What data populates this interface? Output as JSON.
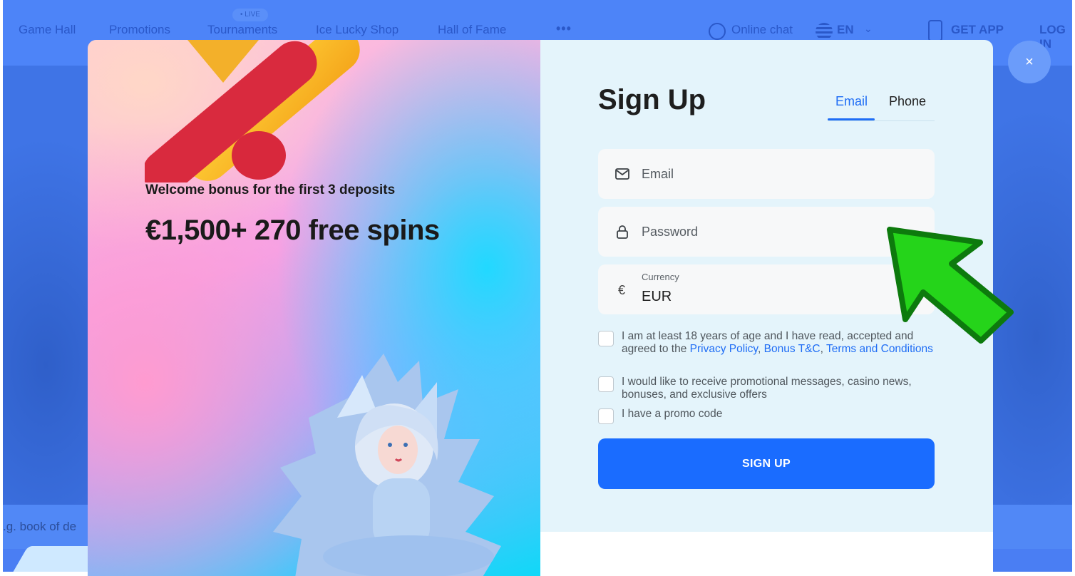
{
  "site": {
    "nav": {
      "game_hall": "Game Hall",
      "promotions": "Promotions",
      "tournaments": "Tournaments",
      "live_badge": "• LIVE",
      "ice_lucky_shop": "Ice Lucky Shop",
      "hall_of_fame": "Hall of Fame",
      "more": "•••",
      "online_chat": "Online chat",
      "language": "EN",
      "language_caret": "⌄",
      "get_app": "GET APP",
      "login": "LOG IN"
    },
    "search_placeholder": ".g. book of de"
  },
  "modal": {
    "close": "×",
    "promo": {
      "subtitle": "Welcome bonus for the first 3 deposits",
      "title": "€1,500+ 270 free spins"
    },
    "form": {
      "title": "Sign Up",
      "tabs": [
        {
          "label": "Email",
          "active": true
        },
        {
          "label": "Phone",
          "active": false
        }
      ],
      "email_placeholder": "Email",
      "password_placeholder": "Password",
      "currency_label": "Currency",
      "currency_symbol": "€",
      "currency_value": "EUR",
      "consent": {
        "text_before": "I am at least 18 years of age and I have read, accepted and agreed to the ",
        "privacy_policy": "Privacy Policy",
        "sep1": ", ",
        "bonus_tc": "Bonus T&C",
        "sep2": ", ",
        "terms": "Terms and Conditions"
      },
      "promo_messages": "I would like to receive promotional messages, casino news, bonuses, and exclusive offers",
      "promo_code": "I have a promo code",
      "submit": "SIGN UP"
    }
  },
  "colors": {
    "accent": "#1a6cff",
    "tab_active": "#1f6df5",
    "arrow": "#22d11a",
    "panel_bg": "#e4f4fb"
  }
}
